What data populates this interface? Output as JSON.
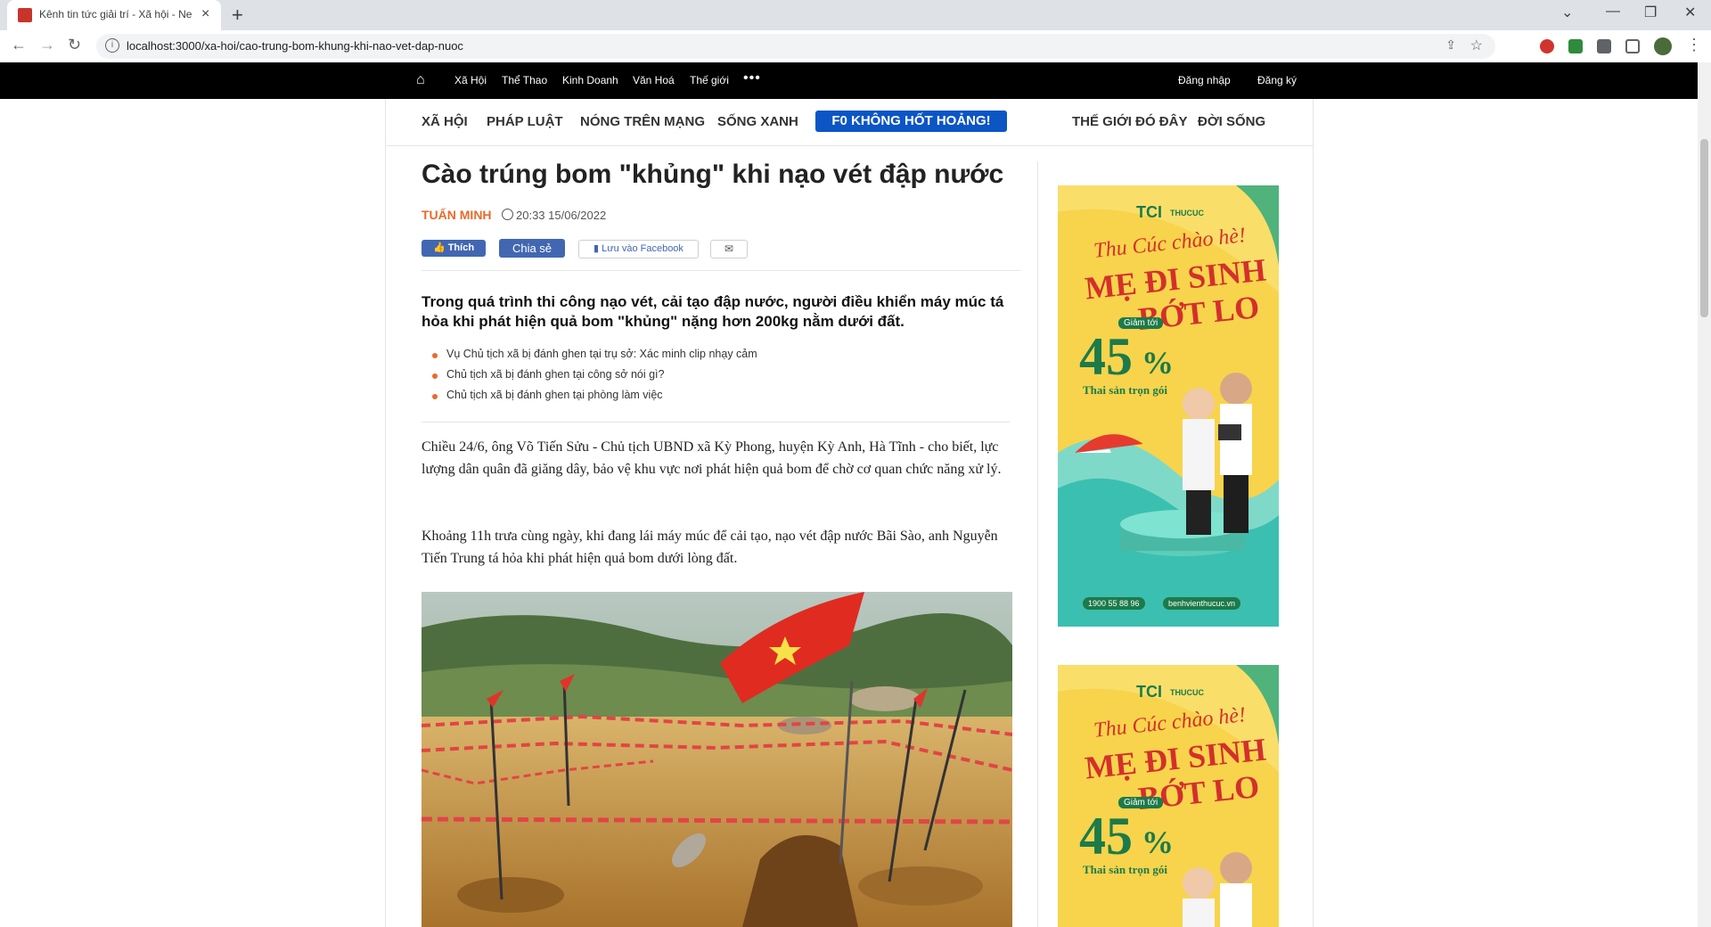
{
  "browser": {
    "tab_title": "Kênh tin tức giải trí - Xã hội - Ne",
    "url": "localhost:3000/xa-hoi/cao-trung-bom-khung-khi-nao-vet-dap-nuoc"
  },
  "topnav": {
    "links": [
      "Xã Hội",
      "Thể Thao",
      "Kinh Doanh",
      "Văn Hoá",
      "Thế giới"
    ],
    "login": "Đăng nhập",
    "register": "Đăng ký"
  },
  "catnav": {
    "items": [
      "XÃ HỘI",
      "PHÁP LUẬT",
      "NÓNG TRÊN MẠNG",
      "SỐNG XANH"
    ],
    "highlight": "F0 KHÔNG HỐT HOẢNG!",
    "right_items": [
      "THẾ GIỚI ĐÓ ĐÂY",
      "ĐỜI SỐNG"
    ]
  },
  "article": {
    "title": "Cào trúng bom \"khủng\" khi nạo vét đập nước",
    "author": "TUẤN MINH",
    "time": "20:33 15/06/2022",
    "like_label": "Thích",
    "share_label": "Chia sẻ",
    "save_label": "Lưu vào Facebook",
    "sapo": "Trong quá trình thi công nạo vét, cải tạo đập nước, người điều khiển máy múc tá hỏa khi phát hiện quả bom \"khủng\" nặng hơn 200kg nằm dưới đất.",
    "related": [
      "Vụ Chủ tịch xã bị đánh ghen tại trụ sở: Xác minh clip nhạy cảm",
      "Chủ tịch xã bị đánh ghen tại công sở nói gì?",
      "Chủ tịch xã bị đánh ghen tại phòng làm việc"
    ],
    "paragraphs": [
      "Chiều 24/6, ông Võ Tiến Sửu - Chủ tịch UBND xã Kỳ Phong, huyện Kỳ Anh, Hà Tĩnh - cho biết, lực lượng dân quân đã giăng dây, bảo vệ khu vực nơi phát hiện quả bom để chờ cơ quan chức năng xử lý.",
      "Khoảng 11h trưa cùng ngày, khi đang lái máy múc để cải tạo, nạo vét đập nước Bãi Sào, anh Nguyễn Tiến Trung tá hỏa khi phát hiện quả bom dưới lòng đất."
    ]
  },
  "ad": {
    "brand": "TCI",
    "brand_sub": "THUCUC",
    "line1": "Thu Cúc chào hè!",
    "line2": "MẸ ĐI SINH",
    "line3": "BỚT LO",
    "discount_label": "Giảm tới",
    "discount": "45",
    "percent": "%",
    "package": "Thai sản trọn gói",
    "phone": "1900 55 88 96",
    "website": "benhvienthucuc.vn"
  },
  "colors": {
    "accent": "#e86a2b",
    "facebook": "#4267b2",
    "f0_badge": "#0b55c5",
    "ad_bg": "#f7d44c",
    "ad_green": "#1d7a4a",
    "ad_red": "#d3302c"
  }
}
